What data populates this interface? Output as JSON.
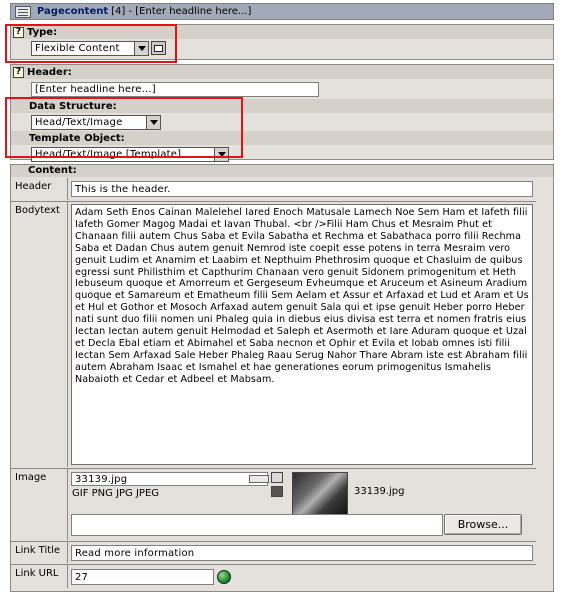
{
  "title_bar": {
    "record_type": "Pagecontent",
    "record_info": "[4] - [Enter headline here...]"
  },
  "type_section": {
    "label": "Type:",
    "value": "Flexible Content"
  },
  "header_section": {
    "label": "Header:",
    "value": "[Enter headline here...]"
  },
  "data_structure": {
    "label": "Data Structure:",
    "value": "Head/Text/Image"
  },
  "template_object": {
    "label": "Template Object:",
    "value": "Head/Text/Image [Template]"
  },
  "content": {
    "label": "Content:",
    "header_label": "Header",
    "header_value": "This is the header.",
    "bodytext_label": "Bodytext",
    "bodytext_value": "Adam Seth Enos Cainan Malelehel Iared Enoch Matusale Lamech Noe Sem Ham et Iafeth filii Iafeth Gomer Magog Madai et Iavan Thubal. <br />Filii Ham Chus et Mesraim Phut et Chanaan filii autem Chus Saba et Evila Sabatha et Rechma et Sabathaca porro filii Rechma Saba et Dadan Chus autem genuit Nemrod iste coepit esse potens in terra Mesraim vero genuit Ludim et Anamim et Laabim et Nepthuim Phethrosim quoque et Chasluim de quibus egressi sunt Philisthim et Capthurim Chanaan vero genuit Sidonem primogenitum et Heth Iebuseum quoque et Amorreum et Gergeseum Evheumque et Aruceum et Asineum Aradium quoque et Samareum et Ematheum filii Sem Aelam et Assur et Arfaxad et Lud et Aram et Us et Hul et Gothor et Mosoch Arfaxad autem genuit Sala qui et ipse genuit Heber porro Heber nati sunt duo filii nomen uni Phaleg quia in diebus eius divisa est terra et nomen fratris eius Iectan Iectan autem genuit Helmodad et Saleph et Asermoth et Iare Aduram quoque et Uzal et Decla Ebal etiam et Abimahel et Saba necnon et Ophir et Evila et Iobab omnes isti filii Iectan Sem Arfaxad Sale Heber Phaleg Raau Serug Nahor Thare Abram iste est Abraham filii autem Abraham Isaac et Ismahel et hae generationes eorum primogenitus Ismahelis Nabaioth et Cedar et Adbeel et Mabsam.",
    "image_label": "Image",
    "image_file": "33139.jpg",
    "image_types": "GIF PNG JPG JPEG",
    "image_caption": "33139.jpg",
    "browse_label": "Browse...",
    "link_title_label": "Link Title",
    "link_title_value": "Read more information",
    "link_url_label": "Link URL",
    "link_url_value": "27"
  },
  "icons": {
    "help": "help-icon",
    "wizard": "wizard-icon",
    "edit": "edit-icon",
    "delete": "trash-icon",
    "link_browser": "globe-link-icon",
    "record": "record-doc-icon"
  },
  "colors": {
    "highlight": "#e0121b",
    "titlebar_bg": "#a2aab8",
    "panel_bg": "#e4e0db"
  }
}
